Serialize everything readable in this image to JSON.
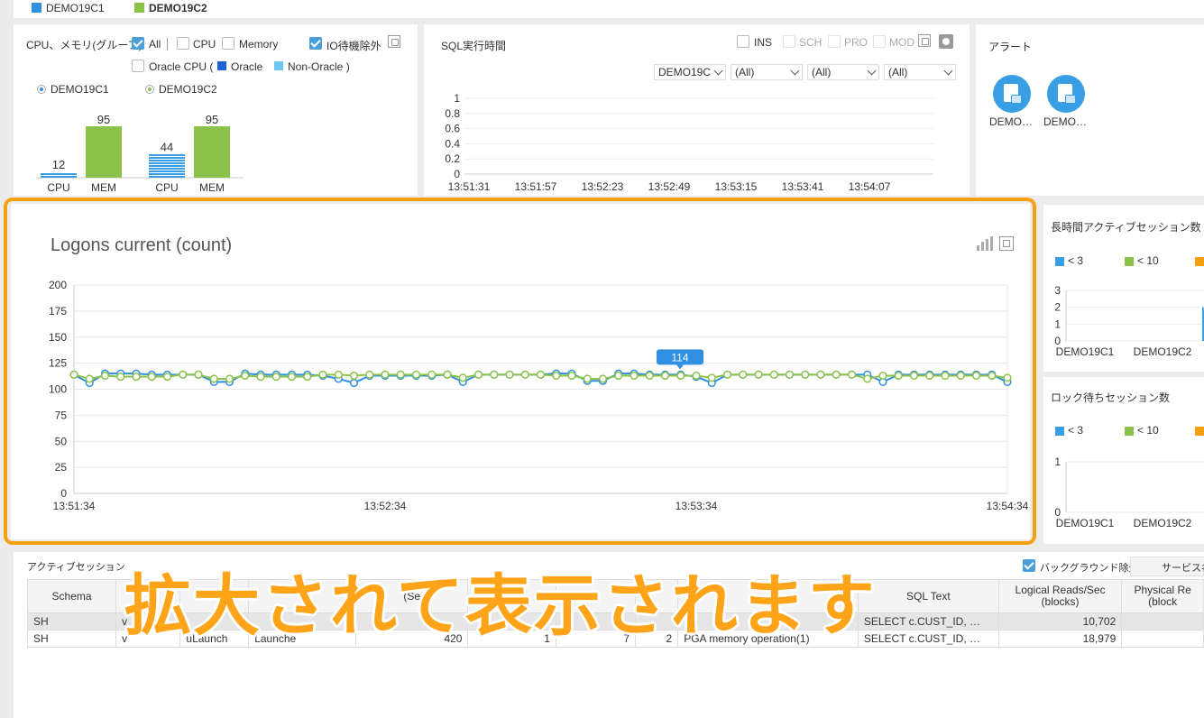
{
  "legend_top": [
    {
      "name": "DEMO19C1",
      "color": "#2f8fe0"
    },
    {
      "name": "DEMO19C2",
      "color": "#8bc34a"
    }
  ],
  "cpu_panel": {
    "title": "CPU、メモリ(グループ)",
    "all_label": "All",
    "cpu_label": "CPU",
    "memory_label": "Memory",
    "io_label": "IO待機除外",
    "oracle_cpu_label": "Oracle CPU (",
    "oracle_label": "Oracle",
    "non_oracle_label": "Non-Oracle )",
    "db1": "DEMO19C1",
    "db2": "DEMO19C2",
    "bars": [
      {
        "db": "DEMO19C1",
        "cpu": 12,
        "mem": 95
      },
      {
        "db": "DEMO19C2",
        "cpu": 44,
        "mem": 95
      }
    ],
    "cpu_axis": "CPU",
    "mem_axis": "MEM"
  },
  "sql_panel": {
    "title": "SQL実行時間",
    "ins": "INS",
    "sch": "SCH",
    "pro": "PRO",
    "mod": "MOD",
    "filters": [
      "DEMO19C",
      "(All)",
      "(All)",
      "(All)"
    ],
    "y_ticks": [
      "1",
      "0.8",
      "0.6",
      "0.4",
      "0.2",
      "0"
    ],
    "x_ticks": [
      "13:51:31",
      "13:51:57",
      "13:52:23",
      "13:52:49",
      "13:53:15",
      "13:53:41",
      "13:54:07"
    ]
  },
  "alert_panel": {
    "title": "アラート",
    "items": [
      "DEMO…",
      "DEMO…"
    ]
  },
  "long_session_panel": {
    "title": "長時間アクティブセッション数",
    "legend": [
      "< 3",
      "< 10"
    ],
    "y_ticks": [
      "3",
      "2",
      "1",
      "0"
    ],
    "categories": [
      "DEMO19C1",
      "DEMO19C2"
    ],
    "values": [
      0,
      2
    ]
  },
  "lock_panel": {
    "title": "ロック待ちセッション数",
    "legend": [
      "< 3",
      "< 10"
    ],
    "y_ticks": [
      "1",
      "0"
    ],
    "categories": [
      "DEMO19C1",
      "DEMO19C2"
    ]
  },
  "chart_data": {
    "type": "line",
    "title": "Logons current (count)",
    "ylim": [
      0,
      200
    ],
    "y_ticks": [
      "200",
      "175",
      "150",
      "125",
      "100",
      "75",
      "50",
      "25",
      "0"
    ],
    "x_ticks": [
      "13:51:34",
      "13:52:34",
      "13:53:34",
      "13:54:34"
    ],
    "tooltip": "114",
    "series": [
      {
        "name": "DEMO19C1",
        "color": "#2f8fe0",
        "values": [
          114,
          106,
          115,
          115,
          115,
          114,
          114,
          114,
          114,
          107,
          107,
          115,
          114,
          114,
          114,
          114,
          113,
          110,
          106,
          113,
          113,
          113,
          113,
          113,
          114,
          107,
          114,
          114,
          114,
          114,
          114,
          115,
          115,
          108,
          108,
          115,
          115,
          114,
          114,
          114,
          112,
          106,
          114,
          114,
          114,
          114,
          114,
          114,
          114,
          114,
          114,
          114,
          107,
          114,
          114,
          114,
          114,
          114,
          114,
          114,
          107
        ]
      },
      {
        "name": "DEMO19C2",
        "color": "#8bc34a",
        "values": [
          114,
          110,
          113,
          112,
          112,
          112,
          112,
          114,
          114,
          110,
          110,
          113,
          112,
          112,
          112,
          112,
          114,
          114,
          113,
          114,
          114,
          114,
          114,
          114,
          114,
          111,
          114,
          114,
          114,
          114,
          114,
          113,
          113,
          110,
          110,
          113,
          113,
          113,
          113,
          113,
          113,
          111,
          114,
          114,
          114,
          114,
          114,
          114,
          114,
          114,
          114,
          110,
          113,
          113,
          113,
          113,
          113,
          113,
          113,
          113,
          111
        ]
      }
    ]
  },
  "session_panel": {
    "title": "アクティブセッション",
    "bg_exclude": "バックグラウンド除外",
    "service": "サービス名",
    "headers": [
      "Schema",
      "",
      "",
      "",
      "(Se",
      "",
      "",
      "",
      "",
      "SQL Text",
      "Logical Reads/Sec\n(blocks)",
      "Physical Re\n(block"
    ],
    "rows": [
      [
        "SH",
        "v",
        "",
        "",
        "",
        "",
        "",
        "",
        "",
        "SELECT c.CUST_ID, …",
        "10,702",
        ""
      ],
      [
        "SH",
        "v",
        "uLaunch",
        "Launche",
        "420",
        "1",
        "7",
        "2",
        "PGA memory operation(1)",
        "SELECT c.CUST_ID, …",
        "18,979",
        ""
      ]
    ]
  },
  "overlay": "拡大されて表示されます"
}
